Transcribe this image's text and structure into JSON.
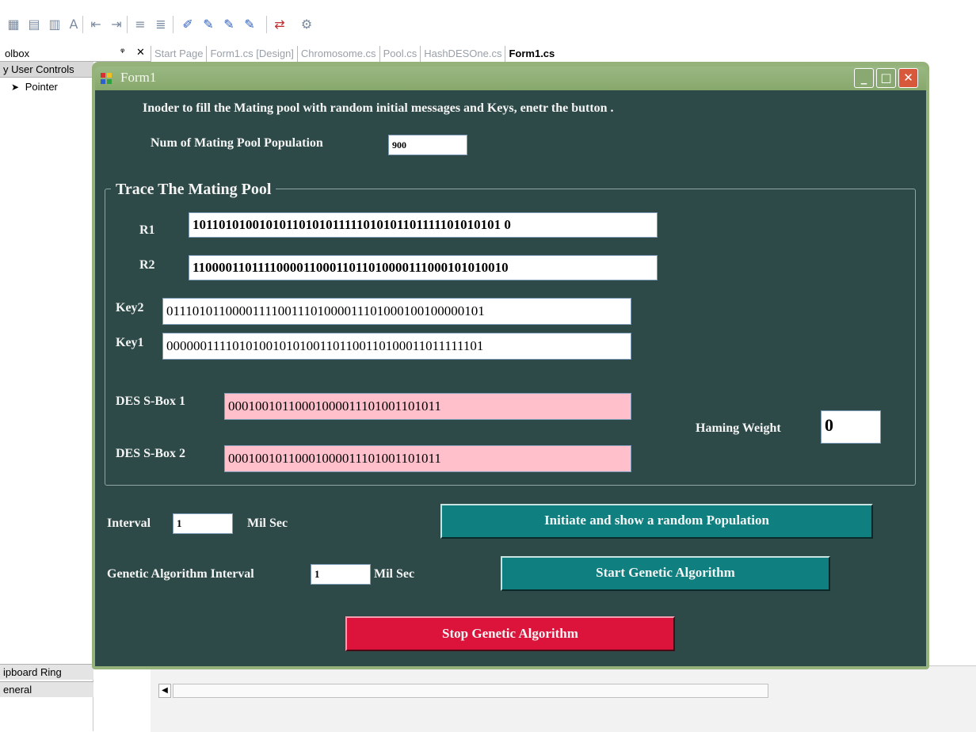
{
  "ide": {
    "toolbox_title": "olbox",
    "toolbox_pin": "ᵠ",
    "toolbox_close": "✕",
    "toolbox_items": [
      "y User Controls",
      "Pointer"
    ],
    "toolbox_bottom_items": [
      "ipboard Ring",
      "eneral"
    ],
    "tabs": [
      "Start Page",
      "Form1.cs [Design]",
      "Chromosome.cs",
      "Pool.cs",
      "HashDESOne.cs",
      "Form1.cs"
    ],
    "active_tab": "Form1.cs"
  },
  "window": {
    "title": "Form1",
    "minimize_glyph": "_",
    "maximize_glyph": "□",
    "close_glyph": "✕"
  },
  "form": {
    "instruction": "Inoder to fill the Mating pool with random initial messages and Keys, enetr the button .",
    "population_label": "Num of Mating Pool Population",
    "population_value": "900",
    "group_title": "Trace The Mating Pool",
    "r1_label": "R1",
    "r1_value": "10110101001010110101011111010101101111101010101 0",
    "r2_label": "R2",
    "r2_value": "110000110111100001100011011010000111000101010010",
    "key2_label": "Key2",
    "key2_value": "011101011000011110011101000011101000100100000101",
    "key1_label": "Key1",
    "key1_value": "000000111101010010101001101100110100011011111101",
    "sbox1_label": "DES S-Box 1",
    "sbox1_value": "00010010110001000011101001101011",
    "sbox2_label": "DES S-Box 2",
    "sbox2_value": "00010010110001000011101001101011",
    "hamming_label": "Haming Weight",
    "hamming_value": "0",
    "interval_label": "Interval",
    "interval_value": "1",
    "interval_unit": "Mil Sec",
    "ga_interval_label": "Genetic Algorithm Interval",
    "ga_interval_value": "1",
    "ga_interval_unit": "Mil Sec",
    "initiate_button": "Initiate and show a random  Population",
    "start_button": "Start Genetic Algorithm",
    "stop_button": "Stop Genetic Algorithm"
  },
  "colors": {
    "form_background": "#2d4a48",
    "button_teal": "#0f7f7f",
    "button_red": "#dc143c",
    "sbox_field": "#ffc0cb",
    "titlebar": "#95b27b"
  }
}
